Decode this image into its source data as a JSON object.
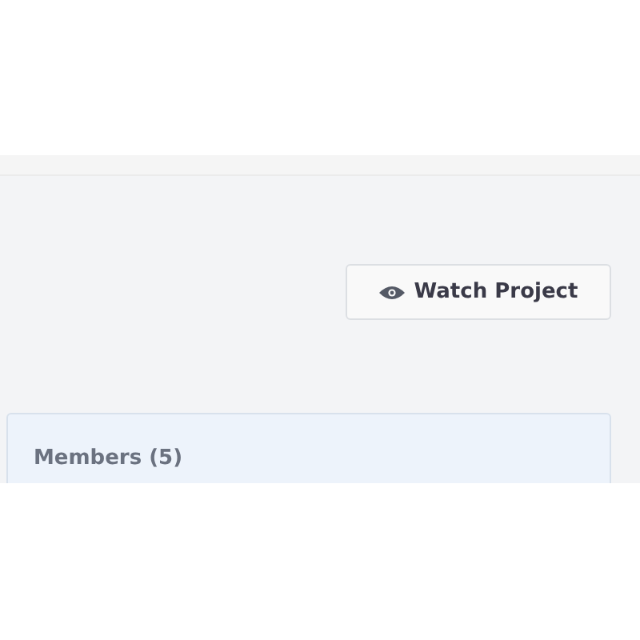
{
  "watch_button": {
    "label": "Watch Project"
  },
  "members_panel": {
    "title": "Members (5)"
  }
}
